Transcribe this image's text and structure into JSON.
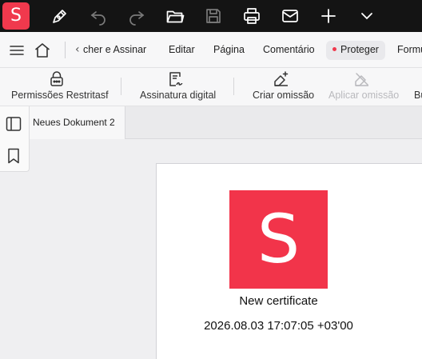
{
  "app": {
    "logo_letter": "S",
    "brand_color": "#f0394d"
  },
  "toolbar": {
    "icons": [
      "pen-icon",
      "undo-icon",
      "redo-icon",
      "folder-open-icon",
      "save-icon",
      "print-icon",
      "mail-icon",
      "plus-icon",
      "chevron-down-icon"
    ]
  },
  "menu": {
    "tabs": [
      {
        "label": "cher e Assinar"
      },
      {
        "label": "Editar"
      },
      {
        "label": "Página"
      },
      {
        "label": "Comentário"
      },
      {
        "label": "Proteger",
        "active": true
      },
      {
        "label": "Formu"
      }
    ],
    "back_chevron": "‹"
  },
  "ribbon": {
    "items": [
      {
        "label": "Permissões Restritasf",
        "icon": "lock-icon",
        "disabled": false
      },
      {
        "label": "Assinatura digital",
        "icon": "signature-icon",
        "disabled": false
      },
      {
        "label": "Criar omissão",
        "icon": "redact-create-icon",
        "disabled": false
      },
      {
        "label": "Aplicar omissão",
        "icon": "redact-apply-icon",
        "disabled": true
      },
      {
        "label": "Bu",
        "icon": "",
        "disabled": false
      }
    ]
  },
  "document": {
    "tab_title": "Neues Dokument 2",
    "cert_logo_letter": "S",
    "cert_title": "New certificate",
    "cert_date": "2026.08.03 17:07:05 +03'00"
  }
}
